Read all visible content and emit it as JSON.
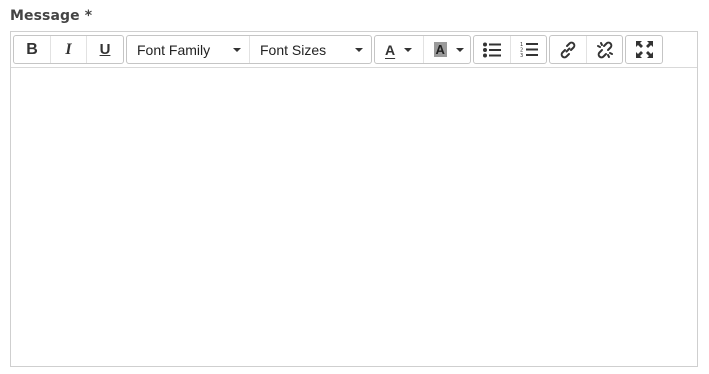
{
  "form": {
    "message_label": "Message *"
  },
  "toolbar": {
    "bold_label": "B",
    "italic_label": "I",
    "underline_label": "U",
    "font_family_label": "Font Family",
    "font_sizes_label": "Font Sizes",
    "font_color_label": "A",
    "bg_color_label": "A",
    "icons": {
      "bullet_list": "bullet-list-icon",
      "numbered_list": "numbered-list-icon",
      "link": "link-icon",
      "unlink": "unlink-icon",
      "fullscreen": "fullscreen-icon"
    }
  },
  "editor": {
    "content": ""
  }
}
